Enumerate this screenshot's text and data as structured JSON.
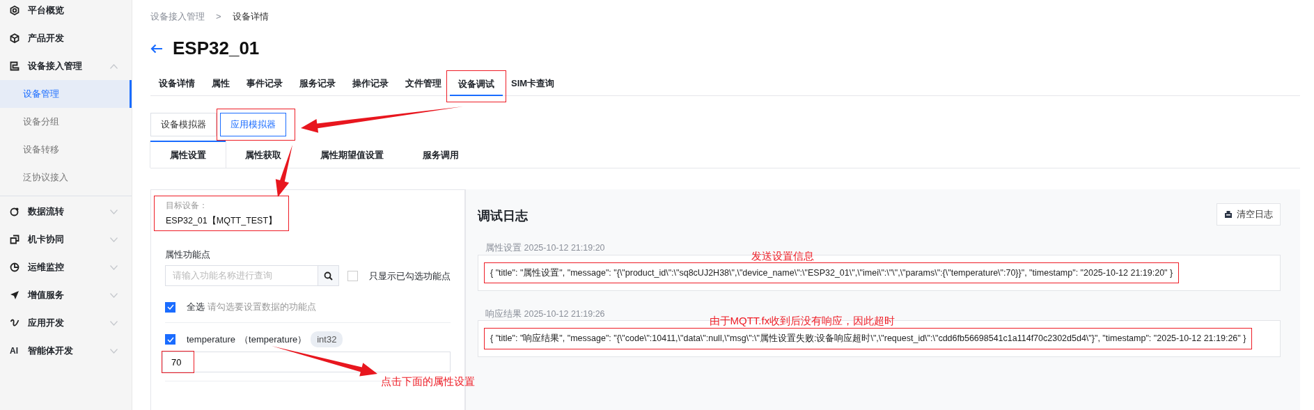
{
  "sidebar": {
    "items": [
      {
        "label": "平台概览",
        "selected": false
      },
      {
        "label": "产品开发",
        "selected": false
      },
      {
        "label": "设备接入管理",
        "selected": false,
        "expanded": true,
        "children": [
          {
            "label": "设备管理",
            "selected": true
          },
          {
            "label": "设备分组",
            "selected": false
          },
          {
            "label": "设备转移",
            "selected": false
          },
          {
            "label": "泛协议接入",
            "selected": false
          }
        ]
      },
      {
        "label": "数据流转",
        "selected": false,
        "expanded": false
      },
      {
        "label": "机卡协同",
        "selected": false,
        "expanded": false
      },
      {
        "label": "运维监控",
        "selected": false,
        "expanded": false
      },
      {
        "label": "增值服务",
        "selected": false,
        "expanded": false
      },
      {
        "label": "应用开发",
        "selected": false,
        "expanded": false
      },
      {
        "label": "智能体开发",
        "selected": false,
        "expanded": false,
        "icon_text": "AI"
      }
    ]
  },
  "breadcrumb": [
    "设备接入管理",
    "设备详情"
  ],
  "breadcrumb_separator": ">",
  "title": "ESP32_01",
  "tabs": [
    {
      "label": "设备详情",
      "selected": false,
      "highlighted": false
    },
    {
      "label": "属性",
      "selected": false,
      "highlighted": false
    },
    {
      "label": "事件记录",
      "selected": false,
      "highlighted": false
    },
    {
      "label": "服务记录",
      "selected": false,
      "highlighted": false
    },
    {
      "label": "操作记录",
      "selected": false,
      "highlighted": false
    },
    {
      "label": "文件管理",
      "selected": false,
      "highlighted": false
    },
    {
      "label": "设备调试",
      "selected": true,
      "highlighted": true
    },
    {
      "label": "SIM卡查询",
      "selected": false,
      "highlighted": false
    }
  ],
  "simulator_modes": [
    {
      "label": "设备模拟器",
      "selected": false,
      "highlighted": false
    },
    {
      "label": "应用模拟器",
      "selected": true,
      "highlighted": true
    }
  ],
  "sub_tabs": [
    {
      "label": "属性设置",
      "selected": true
    },
    {
      "label": "属性获取",
      "selected": false
    },
    {
      "label": "属性期望值设置",
      "selected": false
    },
    {
      "label": "服务调用",
      "selected": false
    }
  ],
  "left_panel": {
    "target_label": "目标设备：",
    "target_value": "ESP32_01【MQTT_TEST】",
    "target_highlighted": true,
    "features_label": "属性功能点",
    "search": {
      "placeholder": "请输入功能名称进行查询"
    },
    "show_checked_only": {
      "label": "只显示已勾选功能点",
      "checked": false
    },
    "select_all": {
      "label": "全选",
      "hint": "请勾选要设置数据的功能点",
      "checked": true
    },
    "properties": [
      {
        "name": "temperature",
        "identifier": "（temperature）",
        "type": "int32",
        "checked": true,
        "value": "70",
        "highlighted": true
      }
    ],
    "note": "点击下面的属性设置"
  },
  "debug_log": {
    "title": "调试日志",
    "clear_button": "清空日志",
    "entries": [
      {
        "label": "属性设置 2025-10-12 21:19:20",
        "note": "发送设置信息",
        "highlighted": true,
        "content": "{ \"title\": \"属性设置\", \"message\": \"{\\\"product_id\\\":\\\"sq8cUJ2H38\\\",\\\"device_name\\\":\\\"ESP32_01\\\",\\\"imei\\\":\\\"\\\",\\\"params\\\":{\\\"temperature\\\":70}}\", \"timestamp\": \"2025-10-12 21:19:20\" }"
      },
      {
        "label": "响应结果 2025-10-12 21:19:26",
        "note": "由于MQTT.fx收到后没有响应，因此超时",
        "highlighted": true,
        "content": "{ \"title\": \"响应结果\", \"message\": \"{\\\"code\\\":10411,\\\"data\\\":null,\\\"msg\\\":\\\"属性设置失败:设备响应超时\\\",\\\"request_id\\\":\\\"cdd6fb56698541c1a114f70c2302d5d4\\\"}\", \"timestamp\": \"2025-10-12 21:19:26\" }"
      }
    ]
  }
}
